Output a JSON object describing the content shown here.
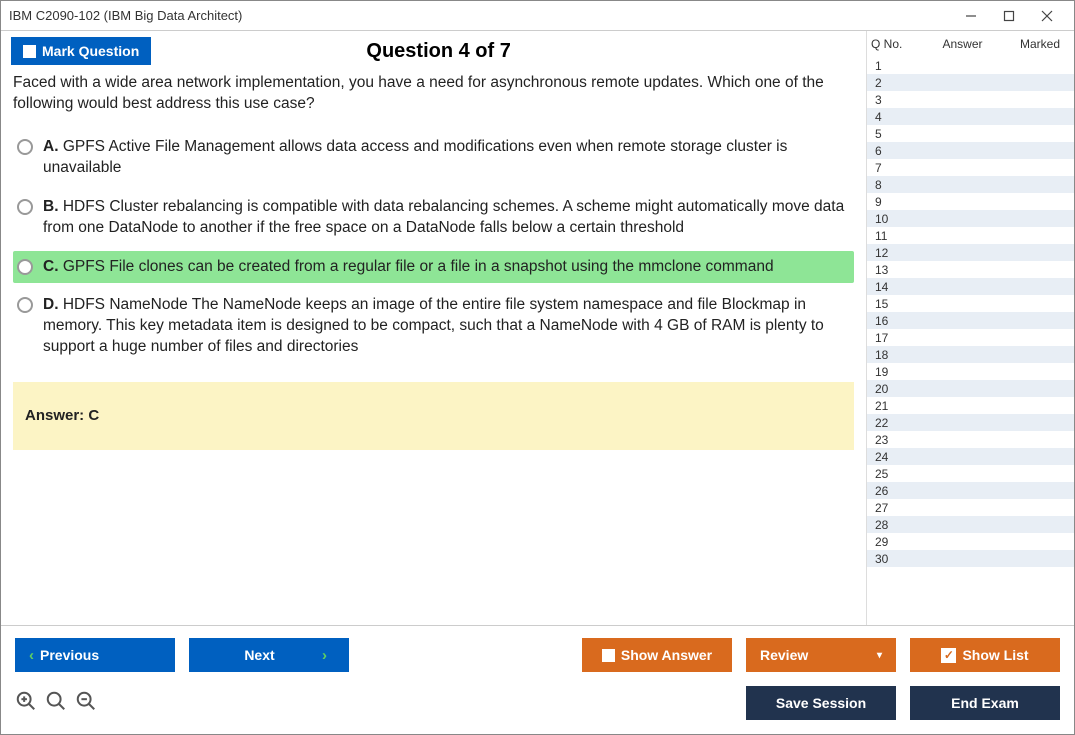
{
  "window": {
    "title": "IBM C2090-102 (IBM Big Data Architect)"
  },
  "header": {
    "mark_label": "Mark Question",
    "question_title": "Question 4 of 7"
  },
  "question": {
    "text": "Faced with a wide area network implementation, you have a need for asynchronous remote updates. Which one of the following would best address this use case?",
    "options": [
      {
        "letter": "A.",
        "text": "GPFS Active File Management allows data access and modifications even when remote storage cluster is unavailable",
        "selected": false
      },
      {
        "letter": "B.",
        "text": "HDFS Cluster rebalancing is compatible with data rebalancing schemes. A scheme might automatically move data from one DataNode to another if the free space on a DataNode falls below a certain threshold",
        "selected": false
      },
      {
        "letter": "C.",
        "text": "GPFS File clones can be created from a regular file or a file in a snapshot using the mmclone command",
        "selected": true
      },
      {
        "letter": "D.",
        "text": "HDFS NameNode The NameNode keeps an image of the entire file system namespace and file Blockmap in memory. This key metadata item is designed to be compact, such that a NameNode with 4 GB of RAM is plenty to support a huge number of files and directories",
        "selected": false
      }
    ],
    "answer_label": "Answer: C"
  },
  "sidebar": {
    "col_qno": "Q No.",
    "col_answer": "Answer",
    "col_marked": "Marked",
    "count": 30
  },
  "footer": {
    "previous": "Previous",
    "next": "Next",
    "show_answer": "Show Answer",
    "review": "Review",
    "show_list": "Show List",
    "save_session": "Save Session",
    "end_exam": "End Exam"
  }
}
